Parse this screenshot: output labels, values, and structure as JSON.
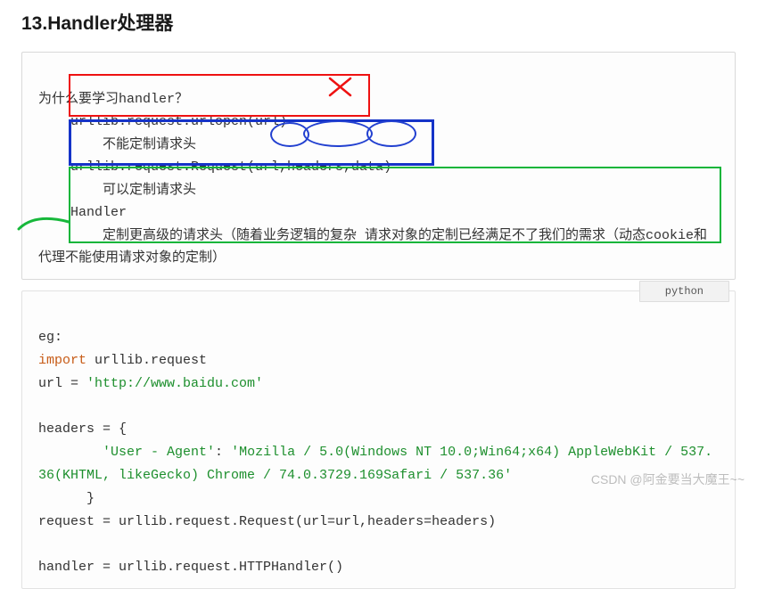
{
  "heading": "13.Handler处理器",
  "block1": {
    "q": "为什么要学习handler？",
    "line1": "    urllib.request.urlopen(url)",
    "line1_note": "        不能定制请求头",
    "line2": "    urllib.request.Request(url,headers,data)",
    "line2_note": "        可以定制请求头",
    "handler_title": "    Handler",
    "handler_body": "        定制更高级的请求头（随着业务逻辑的复杂 请求对象的定制已经满足不了我们的需求（动态cookie和代理不能使用请求对象的定制）"
  },
  "lang_tag": "python",
  "block2": {
    "eg": "eg:",
    "kw_import": "import",
    "import_rest": " urllib.request",
    "url_lhs": "url = ",
    "url_str": "'http://www.baidu.com'",
    "headers_open": "headers = {",
    "ua_key": "'User - Agent'",
    "ua_sep": ": ",
    "ua_val": "'Mozilla / 5.0(Windows NT 10.0;Win64;x64) AppleWebKit / 537.36(KHTML, likeGecko) Chrome / 74.0.3729.169Safari / 537.36'",
    "headers_close": "      }",
    "request_line": "request = urllib.request.Request(url=url,headers=headers)",
    "handler_line": "handler = urllib.request.HTTPHandler()"
  },
  "watermark": "CSDN @阿金要当大魔王~~"
}
